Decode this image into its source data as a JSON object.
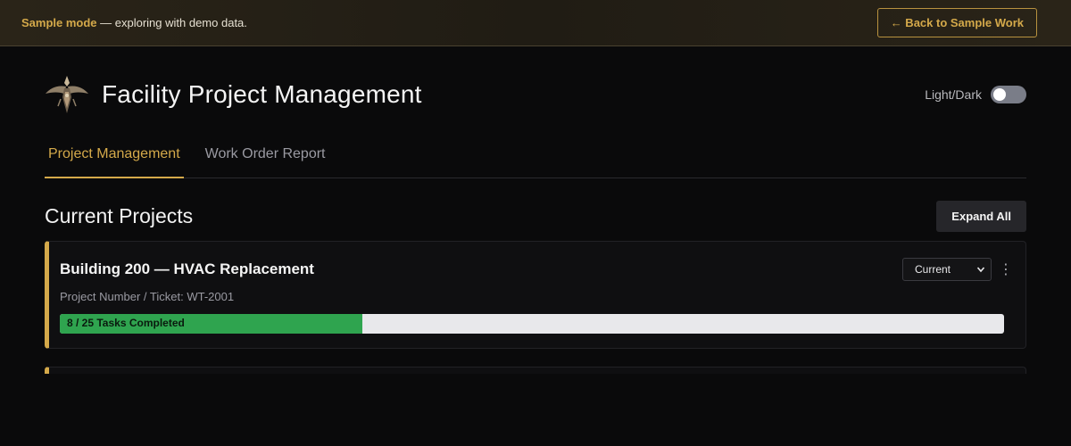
{
  "banner": {
    "mode_label": "Sample mode",
    "message": " — exploring with demo data.",
    "back_label": "← Back to Sample Work"
  },
  "header": {
    "title": "Facility Project Management",
    "logo_icon": "winged-emblem-icon",
    "theme_label": "Light/Dark",
    "theme_dark_enabled": false
  },
  "tabs": [
    {
      "label": "Project Management",
      "active": true
    },
    {
      "label": "Work Order Report",
      "active": false
    }
  ],
  "section": {
    "title": "Current Projects",
    "expand_label": "Expand All"
  },
  "projects": [
    {
      "title": "Building 200 — HVAC Replacement",
      "status": "Current",
      "subtitle": "Project Number / Ticket: WT-2001",
      "tasks_completed": 8,
      "tasks_total": 25,
      "progress_label": "8 / 25 Tasks Completed"
    }
  ],
  "colors": {
    "accent": "#d4a94a",
    "progress_fill": "#2fa44f",
    "progress_track": "#e8e8eb",
    "background": "#0a0a0b"
  }
}
